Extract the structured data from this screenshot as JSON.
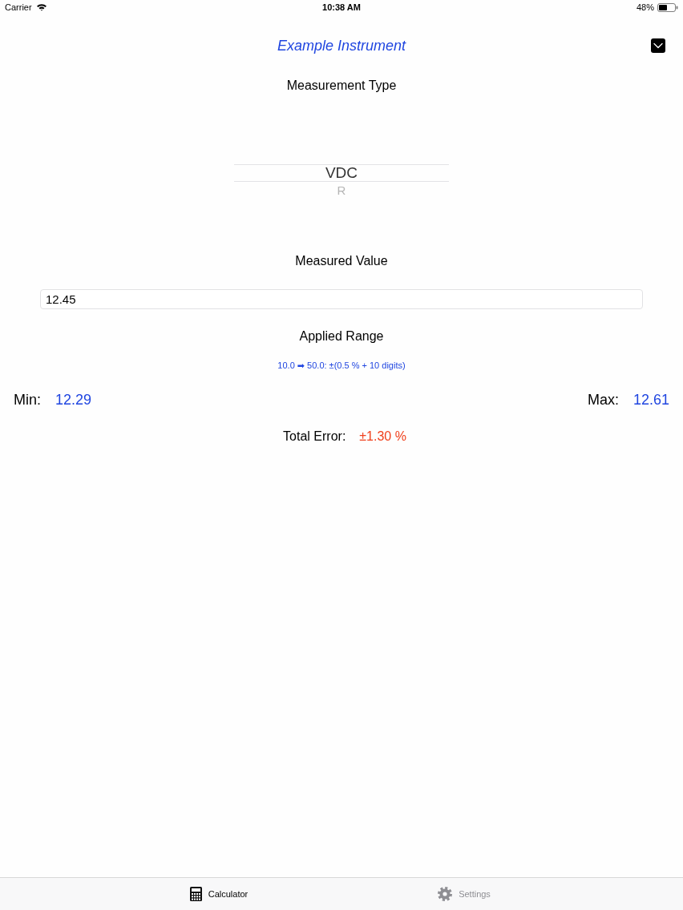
{
  "status_bar": {
    "carrier": "Carrier",
    "time": "10:38 AM",
    "battery": "48%"
  },
  "nav_bar": {
    "title": "Example Instrument"
  },
  "measurement_type": {
    "label": "Measurement Type",
    "options": [
      {
        "label": "VDC",
        "selected": true
      },
      {
        "label": "R",
        "selected": false
      }
    ]
  },
  "measured_value": {
    "label": "Measured Value",
    "value": "12.45"
  },
  "applied_range": {
    "label": "Applied Range",
    "text": "10.0 ➡ 50.0: ±(0.5 % + 10 digits)"
  },
  "limits": [
    {
      "label": "Min:",
      "value": "12.29"
    },
    {
      "label": "Max:",
      "value": "12.61"
    }
  ],
  "total_error": {
    "label": "Total Error:",
    "value": "±1.30 %"
  },
  "tab_bar": [
    {
      "label": "Calculator",
      "kind": "calculator",
      "selected": true
    },
    {
      "label": "Settings",
      "kind": "settings",
      "selected": false
    }
  ]
}
